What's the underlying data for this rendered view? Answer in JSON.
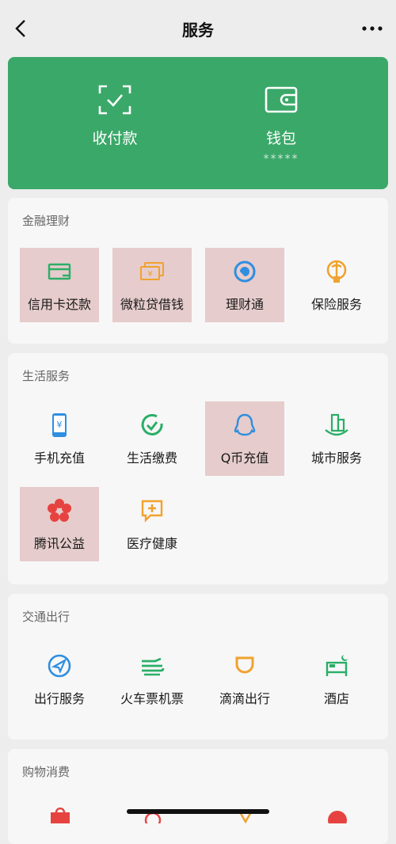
{
  "header": {
    "title": "服务"
  },
  "wallet_card": {
    "pay_label": "收付款",
    "wallet_label": "钱包",
    "wallet_masked": "*****",
    "color": "#3aa869"
  },
  "sections": [
    {
      "title": "金融理财",
      "items": [
        {
          "label": "信用卡还款",
          "icon": "credit-card-icon"
        },
        {
          "label": "微粒贷借钱",
          "icon": "cash-icon"
        },
        {
          "label": "理财通",
          "icon": "wealth-icon"
        },
        {
          "label": "保险服务",
          "icon": "umbrella-icon"
        }
      ]
    },
    {
      "title": "生活服务",
      "items": [
        {
          "label": "手机充值",
          "icon": "phone-icon"
        },
        {
          "label": "生活缴费",
          "icon": "bill-icon"
        },
        {
          "label": "Q币充值",
          "icon": "qq-icon"
        },
        {
          "label": "城市服务",
          "icon": "city-icon"
        },
        {
          "label": "腾讯公益",
          "icon": "charity-icon"
        },
        {
          "label": "医疗健康",
          "icon": "medical-icon"
        }
      ]
    },
    {
      "title": "交通出行",
      "items": [
        {
          "label": "出行服务",
          "icon": "navigation-icon"
        },
        {
          "label": "火车票机票",
          "icon": "train-icon"
        },
        {
          "label": "滴滴出行",
          "icon": "didi-icon"
        },
        {
          "label": "酒店",
          "icon": "hotel-icon"
        }
      ]
    },
    {
      "title": "购物消费",
      "items": []
    }
  ],
  "colors": {
    "highlight": "#e6cccc",
    "blue": "#2f8ee0",
    "green": "#2aae67",
    "orange": "#f0a22e",
    "red": "#e64340"
  }
}
